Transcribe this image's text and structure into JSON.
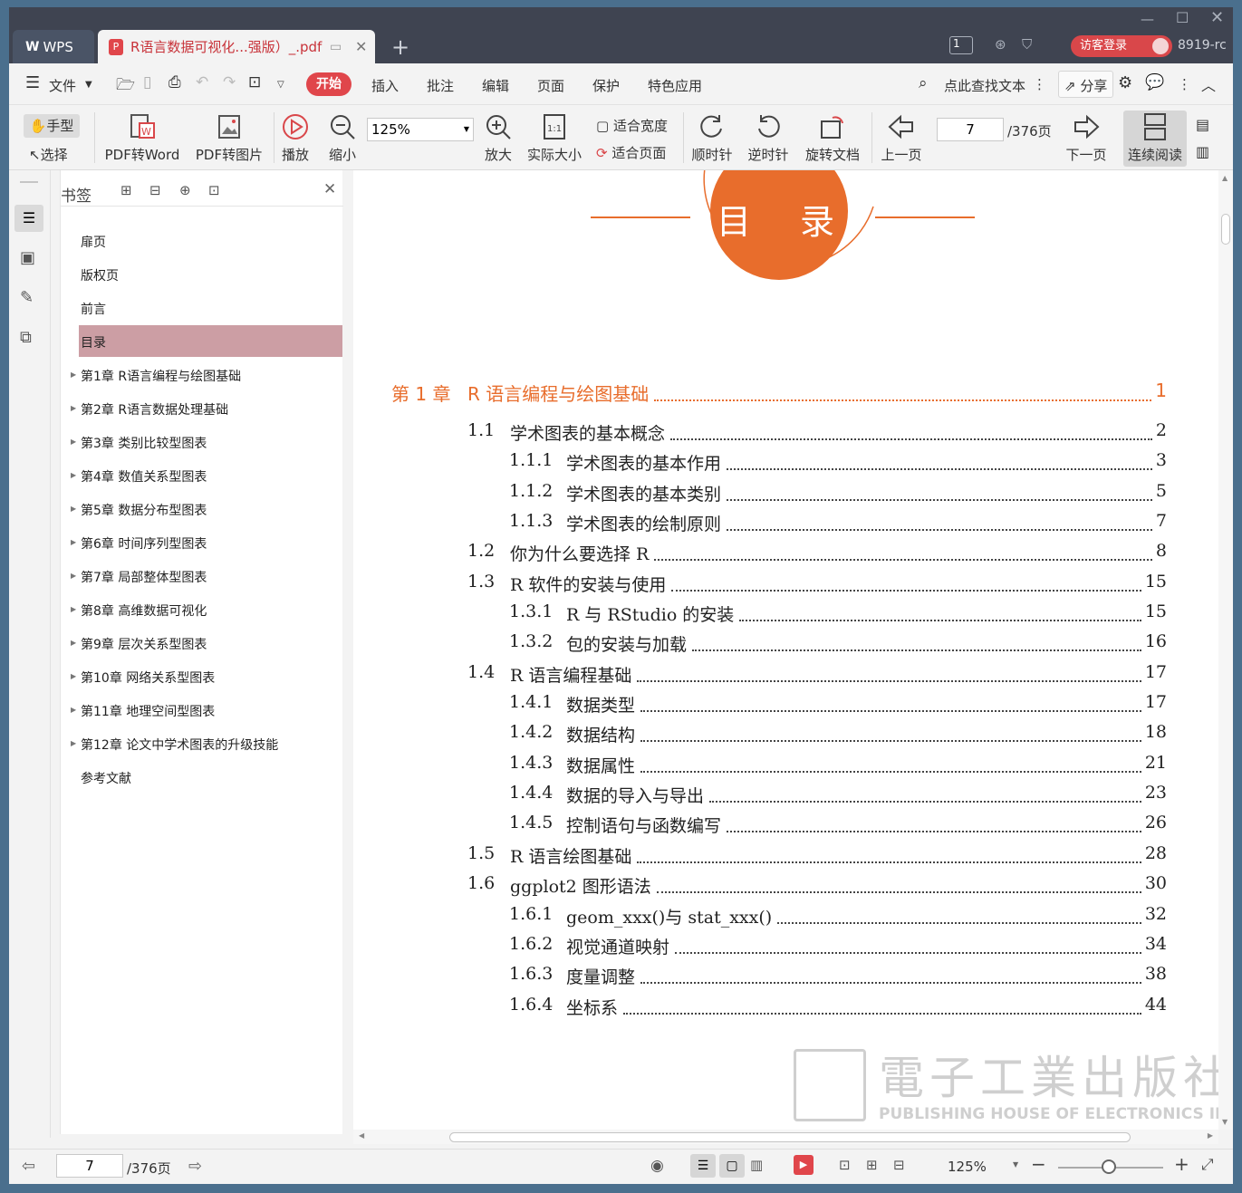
{
  "titlebar": {
    "wps_tab": "WPS",
    "doc_tab_title": "R语言数据可视化...强版）_.pdf",
    "count_badge": "1",
    "login": "访客登录",
    "user_id": "8919-rc"
  },
  "menu": {
    "file": "文件",
    "items": [
      "开始",
      "插入",
      "批注",
      "编辑",
      "页面",
      "保护",
      "特色应用"
    ],
    "search": "点此查找文本",
    "share": "分享"
  },
  "toolbar": {
    "hand": "手型",
    "select": "选择",
    "pdf2word": "PDF转Word",
    "pdf2img": "PDF转图片",
    "play": "播放",
    "zoom_out": "缩小",
    "zoom_value": "125%",
    "zoom_in": "放大",
    "actual": "实际大小",
    "fit_width": "适合宽度",
    "fit_page": "适合页面",
    "cw": "顺时针",
    "ccw": "逆时针",
    "rotate": "旋转文档",
    "prev": "上一页",
    "page": "7",
    "total": "/376页",
    "next": "下一页",
    "continuous": "连续阅读"
  },
  "sidebar": {
    "title": "书签",
    "items": [
      {
        "label": "扉页",
        "expand": false
      },
      {
        "label": "版权页",
        "expand": false
      },
      {
        "label": "前言",
        "expand": false
      },
      {
        "label": "目录",
        "expand": false,
        "selected": true
      },
      {
        "label": "第1章  R语言编程与绘图基础",
        "expand": true
      },
      {
        "label": "第2章  R语言数据处理基础",
        "expand": true
      },
      {
        "label": "第3章  类别比较型图表",
        "expand": true
      },
      {
        "label": "第4章  数值关系型图表",
        "expand": true
      },
      {
        "label": "第5章  数据分布型图表",
        "expand": true
      },
      {
        "label": "第6章  时间序列型图表",
        "expand": true
      },
      {
        "label": "第7章  局部整体型图表",
        "expand": true
      },
      {
        "label": "第8章  高维数据可视化",
        "expand": true
      },
      {
        "label": "第9章  层次关系型图表",
        "expand": true
      },
      {
        "label": "第10章  网络关系型图表",
        "expand": true
      },
      {
        "label": "第11章  地理空间型图表",
        "expand": true
      },
      {
        "label": "第12章  论文中学术图表的升级技能",
        "expand": true
      },
      {
        "label": "参考文献",
        "expand": false
      }
    ]
  },
  "document": {
    "heading": "目　录",
    "toc": [
      {
        "num": "第 1 章",
        "title": "R 语言编程与绘图基础",
        "page": "1",
        "level": 0
      },
      {
        "num": "1.1",
        "title": "学术图表的基本概念",
        "page": "2",
        "level": 1
      },
      {
        "num": "1.1.1",
        "title": "学术图表的基本作用",
        "page": "3",
        "level": 2
      },
      {
        "num": "1.1.2",
        "title": "学术图表的基本类别",
        "page": "5",
        "level": 2
      },
      {
        "num": "1.1.3",
        "title": "学术图表的绘制原则",
        "page": "7",
        "level": 2
      },
      {
        "num": "1.2",
        "title": "你为什么要选择 R",
        "page": "8",
        "level": 1
      },
      {
        "num": "1.3",
        "title": "R 软件的安装与使用",
        "page": "15",
        "level": 1
      },
      {
        "num": "1.3.1",
        "title": "R 与 RStudio 的安装",
        "page": "15",
        "level": 2
      },
      {
        "num": "1.3.2",
        "title": "包的安装与加载",
        "page": "16",
        "level": 2
      },
      {
        "num": "1.4",
        "title": "R 语言编程基础",
        "page": "17",
        "level": 1
      },
      {
        "num": "1.4.1",
        "title": "数据类型",
        "page": "17",
        "level": 2
      },
      {
        "num": "1.4.2",
        "title": "数据结构",
        "page": "18",
        "level": 2
      },
      {
        "num": "1.4.3",
        "title": "数据属性",
        "page": "21",
        "level": 2
      },
      {
        "num": "1.4.4",
        "title": "数据的导入与导出",
        "page": "23",
        "level": 2
      },
      {
        "num": "1.4.5",
        "title": "控制语句与函数编写",
        "page": "26",
        "level": 2
      },
      {
        "num": "1.5",
        "title": "R 语言绘图基础",
        "page": "28",
        "level": 1
      },
      {
        "num": "1.6",
        "title": "ggplot2 图形语法",
        "page": "30",
        "level": 1
      },
      {
        "num": "1.6.1",
        "title": "geom_xxx()与 stat_xxx()",
        "page": "32",
        "level": 2
      },
      {
        "num": "1.6.2",
        "title": "视觉通道映射",
        "page": "34",
        "level": 2
      },
      {
        "num": "1.6.3",
        "title": "度量调整",
        "page": "38",
        "level": 2
      },
      {
        "num": "1.6.4",
        "title": "坐标系",
        "page": "44",
        "level": 2
      }
    ],
    "watermark_cn": "電子工業出版社",
    "watermark_en": "PUBLISHING HOUSE OF ELECTRONICS INDUSTRY"
  },
  "status": {
    "page": "7",
    "total": "/376页",
    "zoom": "125%"
  },
  "colors": {
    "accent": "#e0464b",
    "toc_chapter": "#e86d2c",
    "selected_bookmark": "#cc9ea4"
  }
}
